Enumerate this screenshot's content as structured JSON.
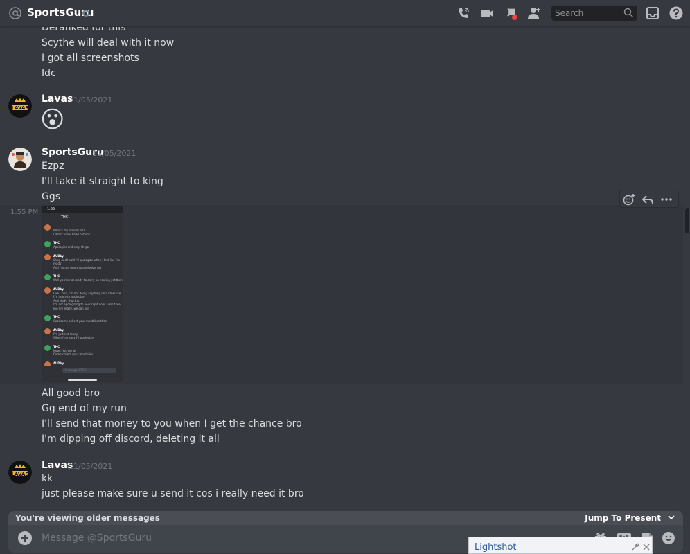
{
  "header": {
    "channel_name": "SportsGuru",
    "search_placeholder": "Search"
  },
  "messages": {
    "top_lines": [
      "Deranked for this",
      "Scythe will deal with it now",
      "I got all screenshots",
      "Idc"
    ],
    "group1": {
      "author": "Lavas",
      "timestamp": "11/05/2021",
      "emoji": "😮"
    },
    "group2": {
      "author": "SportsGuru",
      "timestamp": "11/05/2021",
      "lines": [
        "Ezpz",
        "I'll take it straight to king",
        "Ggs"
      ],
      "hover_time": "1:55 PM",
      "after_lines": [
        "All good bro",
        "Gg end of my run",
        "I'll send that money to you when I get the chance bro",
        "I'm dipping off discord, deleting it all"
      ]
    },
    "group3": {
      "author": "Lavas",
      "timestamp": "11/05/2021",
      "lines": [
        "kk",
        "just please make sure u send it cos i really need it bro"
      ]
    }
  },
  "attachment": {
    "status_time": "1:55",
    "channel": "THC",
    "rows": [
      {
        "name": "",
        "lines": [
          "What's my options lol?",
          "I didn't know I had options"
        ]
      },
      {
        "name": "THC",
        "lines": [
          "Apologize and stay. Or go"
        ]
      },
      {
        "name": "AUDby",
        "lines": [
          "Okay and I said I'll apologize when I feel like I'm",
          "ready",
          "And I'm not ready to apologize yet"
        ]
      },
      {
        "name": "THC",
        "lines": [
          "Well you're not ready to carry on hosting yet then"
        ]
      },
      {
        "name": "AUDby",
        "lines": [
          "Like I said, I'm not doing anything until I feel like",
          "I'm ready to apologize",
          "And that's that bro",
          "I'm not apologizing to your right now, I don't feel",
          "like I'm ready, we can kill"
        ]
      },
      {
        "name": "THC",
        "lines": [
          "Cool come collect your monthlies then"
        ]
      },
      {
        "name": "AUDby",
        "lines": [
          "I'm just not ready",
          "When I'm ready I'll apologize"
        ]
      },
      {
        "name": "THC",
        "lines": [
          "Nope. You're not",
          "Come collect your monthlies"
        ]
      },
      {
        "name": "AUDby",
        "lines": []
      }
    ],
    "input_placeholder": "Message #THC"
  },
  "older_bar": {
    "text": "You're viewing older messages",
    "jump_label": "Jump To Present"
  },
  "composer": {
    "placeholder": "Message @SportsGuru"
  },
  "lightshot": {
    "title": "Lightshot"
  },
  "colors": {
    "background": "#36393f",
    "username": "#ffffff",
    "timestamp": "#72767d",
    "message_text": "#dcddde",
    "lightshot_title": "#2f5a9c"
  }
}
